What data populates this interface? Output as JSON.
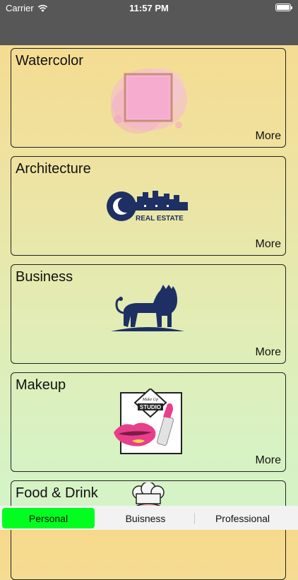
{
  "status_bar": {
    "carrier": "Carrier",
    "time": "11:57 PM"
  },
  "cards": [
    {
      "title": "Watercolor",
      "more": "More"
    },
    {
      "title": "Architecture",
      "more": "More",
      "logo_text": "REAL ESTATE"
    },
    {
      "title": "Business",
      "more": "More"
    },
    {
      "title": "Makeup",
      "more": "More",
      "logo_text_top": "Make Up",
      "logo_text_main": "STUDIO"
    },
    {
      "title": "Food & Drink"
    }
  ],
  "segments": [
    {
      "label": "Personal",
      "selected": true,
      "color": "#00ff1f"
    },
    {
      "label": "Buisness",
      "selected": false
    },
    {
      "label": "Professional",
      "selected": false
    }
  ]
}
